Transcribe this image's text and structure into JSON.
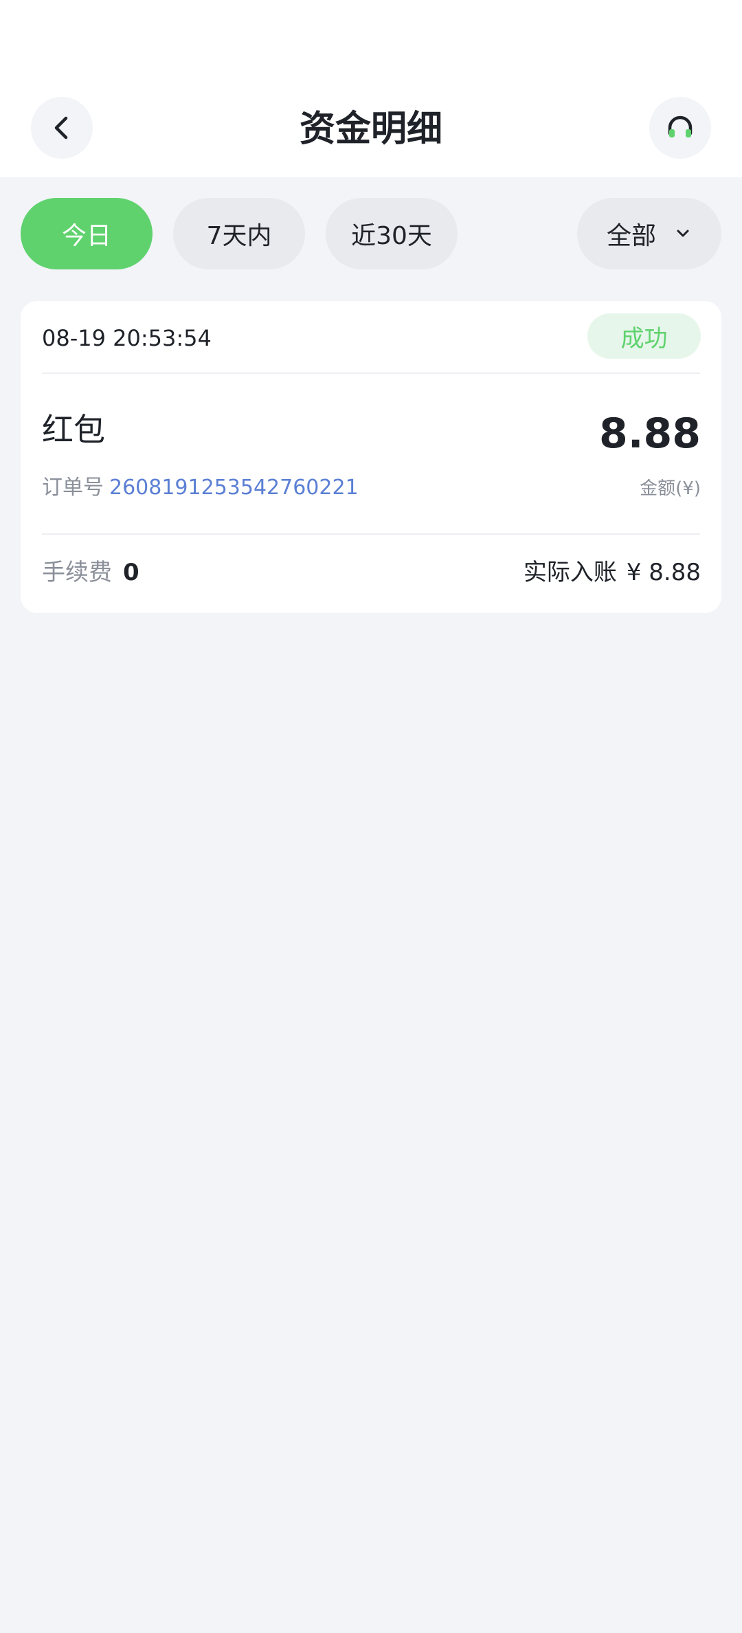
{
  "header": {
    "title": "资金明细",
    "back_icon": "chevron-left-icon",
    "service_icon": "headphones-icon"
  },
  "filters": {
    "today": "今日",
    "days7": "7天内",
    "days30": "近30天",
    "all": "全部",
    "active": "today"
  },
  "record": {
    "time": "08-19 20:53:54",
    "status": "成功",
    "type": "红包",
    "amount": "8.88",
    "order_label": "订单号",
    "order_no": "2608191253542760221",
    "amount_label": "金额(¥)",
    "fee_label": "手续费",
    "fee_value": "0",
    "actual_label": "实际入账",
    "actual_value": "¥ 8.88"
  },
  "colors": {
    "accent": "#5fd26e",
    "link": "#5b7fd4",
    "background": "#f2f4f8"
  }
}
